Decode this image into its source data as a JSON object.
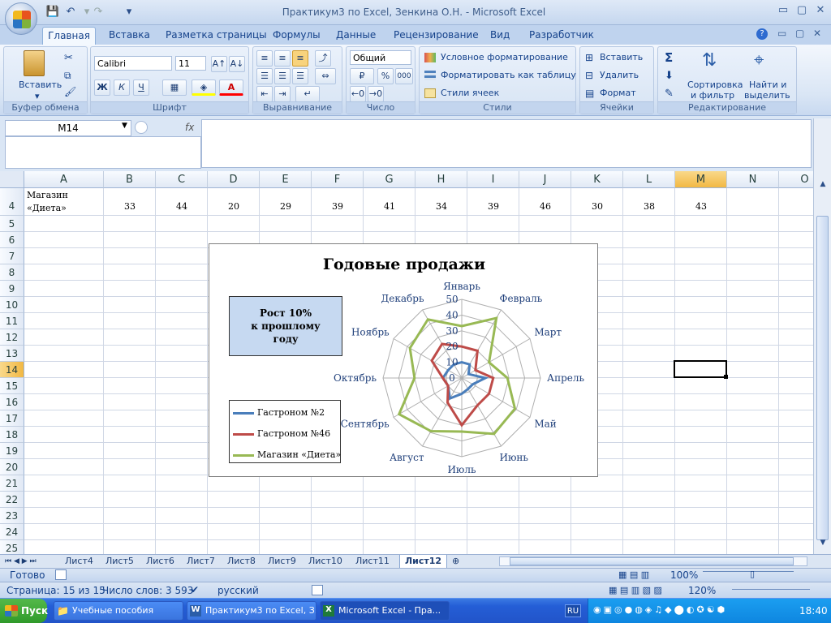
{
  "window": {
    "title": "Практикум3 по Excel, Зенкина О.Н. - Microsoft Excel",
    "close_glyph": "✕",
    "minimize_glyph": "▭",
    "restore_glyph": "▢"
  },
  "ribbon": {
    "tabs": [
      "Главная",
      "Вставка",
      "Разметка страницы",
      "Формулы",
      "Данные",
      "Рецензирование",
      "Вид",
      "Разработчик"
    ],
    "clipboard": {
      "paste": "Вставить",
      "group": "Буфер обмена"
    },
    "font": {
      "name": "Calibri",
      "size": "11",
      "group": "Шрифт",
      "bold": "Ж",
      "italic": "К",
      "underline": "Ч"
    },
    "alignment": {
      "group": "Выравнивание"
    },
    "number": {
      "format": "Общий",
      "group": "Число",
      "percent": "%",
      "thousands": "000"
    },
    "styles": {
      "cond": "Условное форматирование",
      "table": "Форматировать как таблицу",
      "cell": "Стили ячеек",
      "group": "Стили"
    },
    "cells": {
      "insert": "Вставить",
      "delete": "Удалить",
      "format": "Формат",
      "group": "Ячейки"
    },
    "editing": {
      "sort1": "Сортировка",
      "sort2": "и фильтр",
      "find1": "Найти и",
      "find2": "выделить",
      "group": "Редактирование",
      "sigma": "Σ"
    }
  },
  "formula_bar": {
    "name_box": "M14",
    "fx": "fx",
    "value": ""
  },
  "columns": [
    "A",
    "B",
    "C",
    "D",
    "E",
    "F",
    "G",
    "H",
    "I",
    "J",
    "K",
    "L",
    "M",
    "N",
    "O"
  ],
  "rows": [
    "4",
    "5",
    "6",
    "7",
    "8",
    "9",
    "10",
    "11",
    "12",
    "13",
    "14",
    "15",
    "16",
    "17",
    "18",
    "19",
    "20",
    "21",
    "22",
    "23",
    "24",
    "25"
  ],
  "row4": {
    "label_line1": "Магазин",
    "label_line2": "«Диета»",
    "values": [
      "33",
      "44",
      "20",
      "29",
      "39",
      "41",
      "34",
      "39",
      "46",
      "30",
      "38",
      "43"
    ]
  },
  "chart_data": {
    "type": "radar",
    "title": "Годовые продажи",
    "categories": [
      "Январь",
      "Февраль",
      "Март",
      "Апрель",
      "Май",
      "Июнь",
      "Июль",
      "Август",
      "Сентябрь",
      "Октябрь",
      "Ноябрь",
      "Декабрь"
    ],
    "rlim": [
      0,
      50
    ],
    "ticks": [
      "0",
      "10",
      "20",
      "30",
      "40",
      "50"
    ],
    "annotation": {
      "line1": "Рост 10%",
      "line2": "к прошлому",
      "line3": "году"
    },
    "legend_placement": "bottom-left",
    "series": [
      {
        "name": "Гастроном №2",
        "color": "#4a7ebb",
        "values": [
          10,
          10,
          5,
          15,
          8,
          8,
          10,
          15,
          10,
          12,
          10,
          10
        ]
      },
      {
        "name": "Гастроном №46",
        "color": "#be4b48",
        "values": [
          20,
          20,
          10,
          20,
          20,
          20,
          30,
          18,
          10,
          12,
          22,
          25
        ]
      },
      {
        "name": "Магазин «Диета»",
        "color": "#98b954",
        "values": [
          33,
          44,
          20,
          29,
          39,
          41,
          34,
          39,
          46,
          30,
          38,
          43
        ]
      }
    ]
  },
  "sheet_tabs": [
    "Лист4",
    "Лист5",
    "Лист6",
    "Лист7",
    "Лист8",
    "Лист9",
    "Лист10",
    "Лист11",
    "Лист12"
  ],
  "active_sheet": "Лист12",
  "status": {
    "ready": "Готово",
    "zoom1": "100%",
    "page": "Страница: 15 из 15",
    "words": "Число слов: 3 593",
    "lang": "русский",
    "zoom2": "120%"
  },
  "taskbar": {
    "start": "Пуск",
    "tasks": [
      "Учебные пособия",
      "Практикум3 по Excel, З...",
      "Microsoft Excel - Пра..."
    ],
    "lang": "RU",
    "clock": "18:40"
  }
}
